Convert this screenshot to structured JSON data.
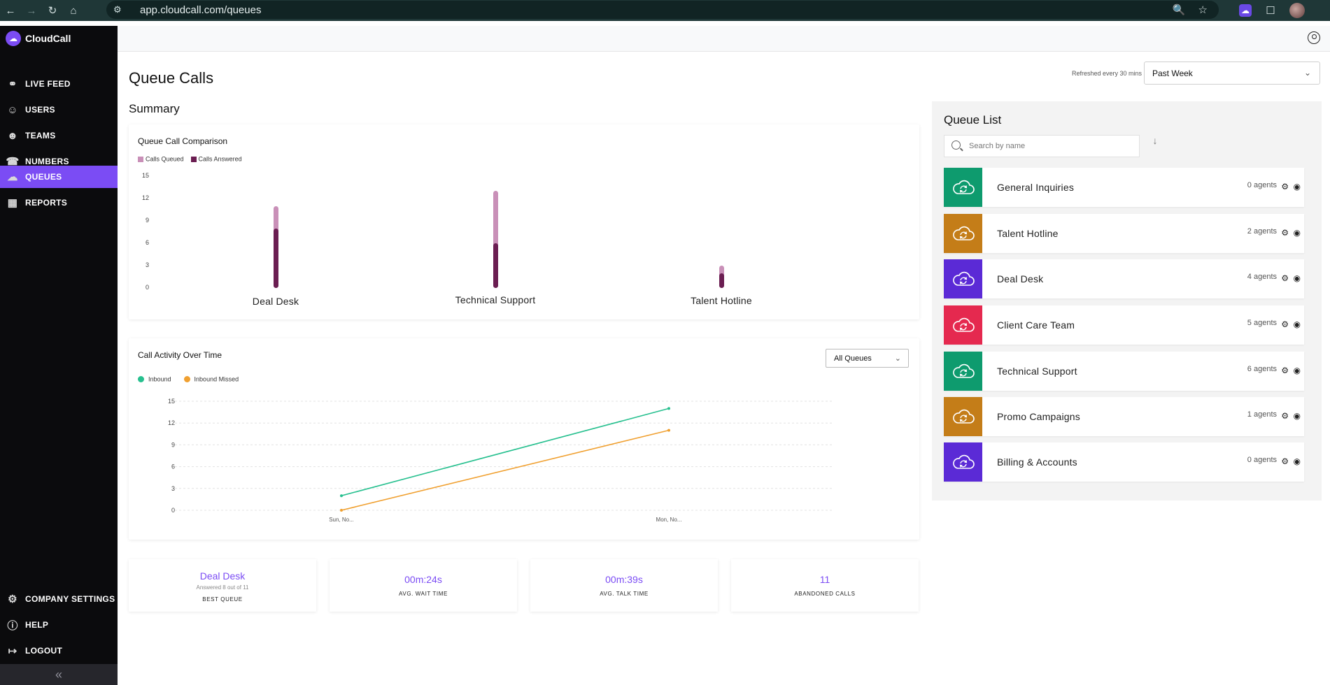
{
  "browser": {
    "url": "app.cloudcall.com/queues",
    "icons": [
      "back-icon",
      "forward-icon",
      "reload-icon",
      "home-icon",
      "site-settings-icon",
      "zoom-icon",
      "bookmark-star-icon",
      "extension-icon",
      "puzzle-icon",
      "profile-avatar"
    ]
  },
  "brand": {
    "name": "CloudCall"
  },
  "sidebar": {
    "items": [
      {
        "label": "LIVE FEED",
        "icon": "headset-icon"
      },
      {
        "label": "USERS",
        "icon": "user-icon"
      },
      {
        "label": "TEAMS",
        "icon": "team-icon"
      },
      {
        "label": "NUMBERS",
        "icon": "phone-icon"
      },
      {
        "label": "QUEUES",
        "icon": "cloud-queue-icon",
        "active": true
      },
      {
        "label": "REPORTS",
        "icon": "reports-icon"
      }
    ],
    "bottom_items": [
      {
        "label": "COMPANY SETTINGS",
        "icon": "gear-icon"
      },
      {
        "label": "HELP",
        "icon": "help-icon"
      },
      {
        "label": "LOGOUT",
        "icon": "logout-icon"
      }
    ],
    "collapse_icon": "«"
  },
  "header": {
    "title": "Queue Calls",
    "refresh_note": "Refreshed every 30 mins",
    "period": "Past Week"
  },
  "summary": {
    "title": "Summary",
    "comparison_title": "Queue Call Comparison",
    "activity_title": "Call Activity Over Time",
    "queue_filter": "All Queues"
  },
  "chart_data": [
    {
      "type": "bar",
      "title": "Queue Call Comparison",
      "categories": [
        "Deal Desk",
        "Technical Support",
        "Talent Hotline"
      ],
      "series": [
        {
          "name": "Calls Queued",
          "values": [
            11,
            13,
            3
          ],
          "color": "#c990b8"
        },
        {
          "name": "Calls Answered",
          "values": [
            8,
            6,
            2
          ],
          "color": "#6b1e52"
        }
      ],
      "yticks": [
        0,
        3,
        6,
        9,
        12,
        15
      ],
      "ylim": [
        0,
        15
      ],
      "legend": "top-left"
    },
    {
      "type": "line",
      "title": "Call Activity Over Time",
      "x": [
        "Sun, No...",
        "Mon, No..."
      ],
      "series": [
        {
          "name": "Inbound",
          "values": [
            2,
            14
          ],
          "color": "#27c08f"
        },
        {
          "name": "Inbound Missed",
          "values": [
            0,
            11
          ],
          "color": "#f0a030"
        }
      ],
      "yticks": [
        0,
        3,
        6,
        9,
        12,
        15
      ],
      "ylim": [
        0,
        15
      ],
      "grid": true,
      "legend": "top-left"
    }
  ],
  "stats": [
    {
      "value": "Deal Desk",
      "sub": "Answered 8 out of 11",
      "label": "BEST QUEUE"
    },
    {
      "value": "00m:24s",
      "label": "AVG. WAIT TIME"
    },
    {
      "value": "00m:39s",
      "label": "AVG. TALK TIME"
    },
    {
      "value": "11",
      "label": "ABANDONED CALLS"
    }
  ],
  "queue_list": {
    "title": "Queue List",
    "search_placeholder": "Search by name",
    "queues": [
      {
        "name": "General Inquiries",
        "agents": "0 agents",
        "color": "#0e9b6e"
      },
      {
        "name": "Talent Hotline",
        "agents": "2 agents",
        "color": "#c47d18"
      },
      {
        "name": "Deal Desk",
        "agents": "4 agents",
        "color": "#5b2ad6"
      },
      {
        "name": "Client Care Team",
        "agents": "5 agents",
        "color": "#e5294f"
      },
      {
        "name": "Technical Support",
        "agents": "6 agents",
        "color": "#0e9b6e"
      },
      {
        "name": "Promo Campaigns",
        "agents": "1 agents",
        "color": "#c47d18"
      },
      {
        "name": "Billing & Accounts",
        "agents": "0 agents",
        "color": "#5b2ad6"
      }
    ]
  }
}
